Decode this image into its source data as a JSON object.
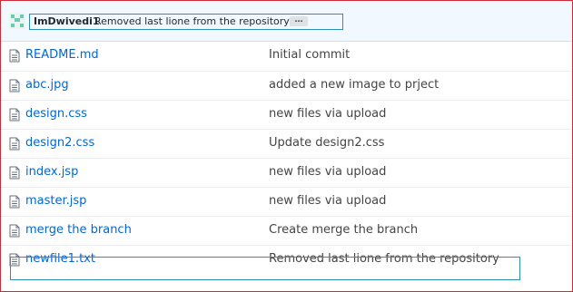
{
  "commit": {
    "author": "ImDwivedi1",
    "message": "Removed last lione from the repository",
    "ellipsis": "…"
  },
  "files": [
    {
      "name": "README.md",
      "message": "Initial commit"
    },
    {
      "name": "abc.jpg",
      "message": "added a new image to prject"
    },
    {
      "name": "design.css",
      "message": "new files via upload"
    },
    {
      "name": "design2.css",
      "message": "Update design2.css"
    },
    {
      "name": "index.jsp",
      "message": "new files via upload"
    },
    {
      "name": "master.jsp",
      "message": "new files via upload"
    },
    {
      "name": "merge the branch",
      "message": "Create merge the branch"
    },
    {
      "name": "newfile1.txt",
      "message": "Removed last lione from the repository"
    }
  ],
  "colors": {
    "link": "#0366d6",
    "border": "#cf2a3a",
    "highlight": "#2b8fb8"
  }
}
